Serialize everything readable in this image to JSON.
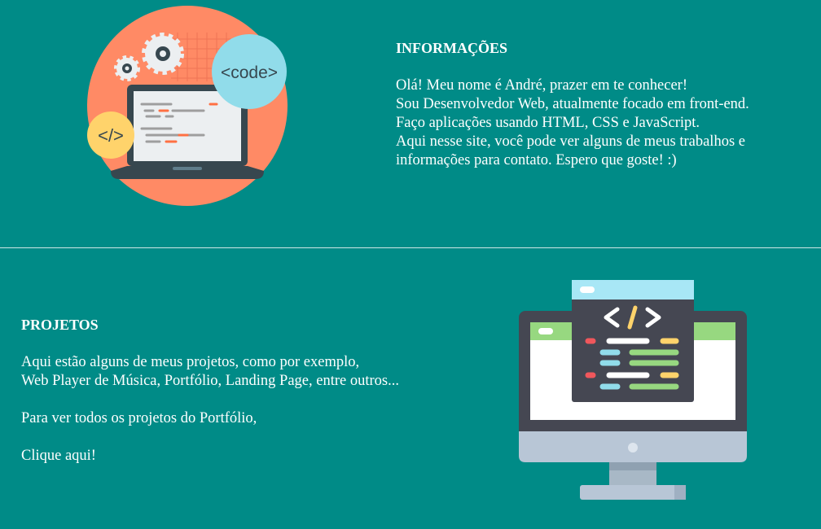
{
  "info": {
    "heading": "INFORMAÇÕES",
    "lines": [
      "Olá! Meu nome é André, prazer em te conhecer!",
      "Sou Desenvolvedor Web, atualmente focado em front-end.",
      "Faço aplicações usando HTML, CSS e JavaScript.",
      "Aqui nesse site, você pode ver alguns de meus trabalhos e",
      "informações para contato. Espero que goste! :)"
    ],
    "illustration": {
      "code_badge": "<code>",
      "tag_badge": "</>"
    }
  },
  "projects": {
    "heading": "PROJETOS",
    "lines": [
      "Aqui estão alguns de meus projetos, como por exemplo,",
      "Web Player de Música, Portfólio, Landing Page, entre outros..."
    ],
    "portfolio_text": "Para ver todos os projetos do Portfólio,",
    "link_label": "Clique aqui!"
  },
  "colors": {
    "background": "#008b87",
    "text": "#ffffff",
    "circle": "#ff8a65",
    "badge_blue": "#91dcea",
    "badge_yellow": "#ffd36b"
  }
}
